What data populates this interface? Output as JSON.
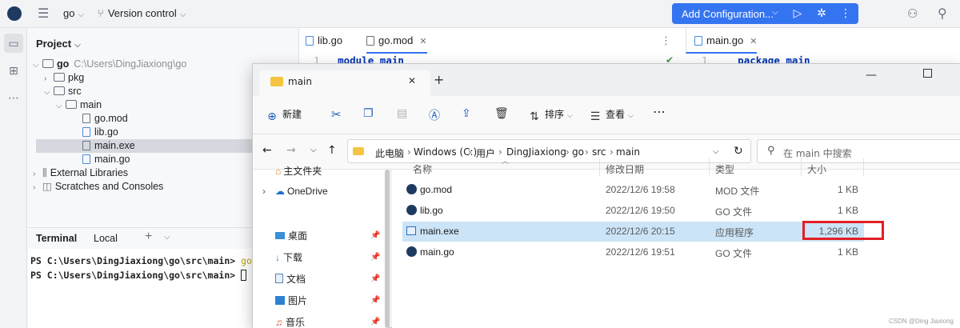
{
  "topbar": {
    "project": "go",
    "vcs": "Version control",
    "run_config": "Add Configuration..."
  },
  "project_panel": {
    "title": "Project",
    "tree": [
      {
        "label": "go",
        "path": "C:\\Users\\DingJiaxiong\\go"
      },
      {
        "label": "pkg"
      },
      {
        "label": "src"
      },
      {
        "label": "main"
      },
      {
        "label": "go.mod"
      },
      {
        "label": "lib.go"
      },
      {
        "label": "main.exe"
      },
      {
        "label": "main.go"
      },
      {
        "label": "External Libraries"
      },
      {
        "label": "Scratches and Consoles"
      }
    ]
  },
  "terminal": {
    "title": "Terminal",
    "tab": "Local",
    "lines": [
      {
        "prompt": "PS C:\\Users\\DingJiaxiong\\go\\src\\main>",
        "cmd": "go"
      },
      {
        "prompt": "PS C:\\Users\\DingJiaxiong\\go\\src\\main>",
        "cmd": ""
      }
    ]
  },
  "editor": {
    "tabs": [
      "lib.go",
      "go.mod",
      "main.go"
    ],
    "left_code": {
      "line": "1",
      "kw": "module",
      "rest": "main"
    },
    "right_code": {
      "line": "1",
      "kw": "package",
      "rest": "main"
    }
  },
  "explorer": {
    "tab_title": "main",
    "toolbar": {
      "new": "新建",
      "sort": "排序",
      "view": "查看"
    },
    "breadcrumb": [
      "此电脑",
      "Windows (C:)",
      "用户",
      "DingJiaxiong",
      "go",
      "src",
      "main"
    ],
    "search_placeholder": "在 main 中搜索",
    "nav": [
      {
        "label": "主文件夹",
        "pinned": false
      },
      {
        "label": "OneDrive",
        "pinned": false
      },
      {
        "label": "桌面",
        "pinned": true
      },
      {
        "label": "下载",
        "pinned": true
      },
      {
        "label": "文档",
        "pinned": true
      },
      {
        "label": "图片",
        "pinned": true
      },
      {
        "label": "音乐",
        "pinned": true
      }
    ],
    "columns": {
      "name": "名称",
      "date": "修改日期",
      "type": "类型",
      "size": "大小"
    },
    "files": [
      {
        "name": "go.mod",
        "date": "2022/12/6 19:58",
        "type": "MOD 文件",
        "size": "1 KB"
      },
      {
        "name": "lib.go",
        "date": "2022/12/6 19:50",
        "type": "GO 文件",
        "size": "1 KB"
      },
      {
        "name": "main.exe",
        "date": "2022/12/6 20:15",
        "type": "应用程序",
        "size": "1,296 KB"
      },
      {
        "name": "main.go",
        "date": "2022/12/6 19:51",
        "type": "GO 文件",
        "size": "1 KB"
      }
    ]
  },
  "watermark": "CSDN @Ding Jiaxiong",
  "colors": {
    "accent": "#3574f0",
    "selection": "#cce4f7",
    "highlight": "#e21f26"
  }
}
